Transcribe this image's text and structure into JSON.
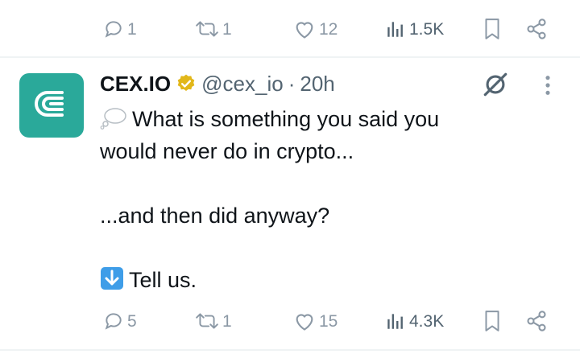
{
  "top_actions": {
    "replies": "1",
    "retweets": "1",
    "likes": "12",
    "views": "1.5K"
  },
  "tweet": {
    "display_name": "CEX.IO",
    "handle": "@cex_io",
    "separator": "·",
    "time": "20h",
    "line1": "What is something you said you",
    "line2": "would never do in crypto...",
    "line3": "...and then did anyway?",
    "line4": "Tell us.",
    "avatar_color": "#2aa99a",
    "verified_color": "#e2b719"
  },
  "bottom_actions": {
    "replies": "5",
    "retweets": "1",
    "likes": "15",
    "views": "4.3K"
  },
  "icons": {
    "reply": "speech-bubble-icon",
    "retweet": "retweet-icon",
    "like": "heart-icon",
    "views": "bar-chart-icon",
    "bookmark": "bookmark-icon",
    "share": "share-icon",
    "grok": "grok-icon",
    "more": "more-icon",
    "thought": "thought-balloon-icon",
    "arrow": "down-arrow-icon"
  }
}
